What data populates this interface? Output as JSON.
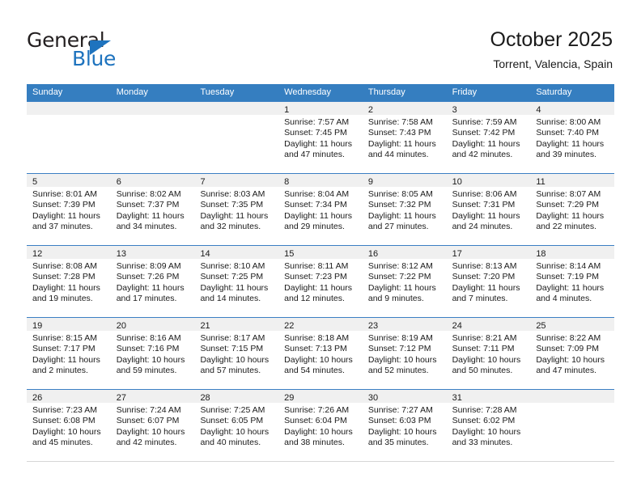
{
  "logo": {
    "name_part1": "General",
    "name_part2": "Blue",
    "accent_color": "#1e73be"
  },
  "header": {
    "title": "October 2025",
    "subtitle": "Torrent, Valencia, Spain"
  },
  "theme": {
    "header_bar_color": "#357ec0",
    "date_strip_color": "#f0f0f0",
    "row_border_color": "#3b7fc4"
  },
  "weekdays": [
    "Sunday",
    "Monday",
    "Tuesday",
    "Wednesday",
    "Thursday",
    "Friday",
    "Saturday"
  ],
  "weeks": [
    [
      {
        "day": "",
        "sunrise": "",
        "sunset": "",
        "daylight1": "",
        "daylight2": "",
        "empty": true
      },
      {
        "day": "",
        "sunrise": "",
        "sunset": "",
        "daylight1": "",
        "daylight2": "",
        "empty": true
      },
      {
        "day": "",
        "sunrise": "",
        "sunset": "",
        "daylight1": "",
        "daylight2": "",
        "empty": true
      },
      {
        "day": "1",
        "sunrise": "Sunrise: 7:57 AM",
        "sunset": "Sunset: 7:45 PM",
        "daylight1": "Daylight: 11 hours",
        "daylight2": "and 47 minutes."
      },
      {
        "day": "2",
        "sunrise": "Sunrise: 7:58 AM",
        "sunset": "Sunset: 7:43 PM",
        "daylight1": "Daylight: 11 hours",
        "daylight2": "and 44 minutes."
      },
      {
        "day": "3",
        "sunrise": "Sunrise: 7:59 AM",
        "sunset": "Sunset: 7:42 PM",
        "daylight1": "Daylight: 11 hours",
        "daylight2": "and 42 minutes."
      },
      {
        "day": "4",
        "sunrise": "Sunrise: 8:00 AM",
        "sunset": "Sunset: 7:40 PM",
        "daylight1": "Daylight: 11 hours",
        "daylight2": "and 39 minutes."
      }
    ],
    [
      {
        "day": "5",
        "sunrise": "Sunrise: 8:01 AM",
        "sunset": "Sunset: 7:39 PM",
        "daylight1": "Daylight: 11 hours",
        "daylight2": "and 37 minutes."
      },
      {
        "day": "6",
        "sunrise": "Sunrise: 8:02 AM",
        "sunset": "Sunset: 7:37 PM",
        "daylight1": "Daylight: 11 hours",
        "daylight2": "and 34 minutes."
      },
      {
        "day": "7",
        "sunrise": "Sunrise: 8:03 AM",
        "sunset": "Sunset: 7:35 PM",
        "daylight1": "Daylight: 11 hours",
        "daylight2": "and 32 minutes."
      },
      {
        "day": "8",
        "sunrise": "Sunrise: 8:04 AM",
        "sunset": "Sunset: 7:34 PM",
        "daylight1": "Daylight: 11 hours",
        "daylight2": "and 29 minutes."
      },
      {
        "day": "9",
        "sunrise": "Sunrise: 8:05 AM",
        "sunset": "Sunset: 7:32 PM",
        "daylight1": "Daylight: 11 hours",
        "daylight2": "and 27 minutes."
      },
      {
        "day": "10",
        "sunrise": "Sunrise: 8:06 AM",
        "sunset": "Sunset: 7:31 PM",
        "daylight1": "Daylight: 11 hours",
        "daylight2": "and 24 minutes."
      },
      {
        "day": "11",
        "sunrise": "Sunrise: 8:07 AM",
        "sunset": "Sunset: 7:29 PM",
        "daylight1": "Daylight: 11 hours",
        "daylight2": "and 22 minutes."
      }
    ],
    [
      {
        "day": "12",
        "sunrise": "Sunrise: 8:08 AM",
        "sunset": "Sunset: 7:28 PM",
        "daylight1": "Daylight: 11 hours",
        "daylight2": "and 19 minutes."
      },
      {
        "day": "13",
        "sunrise": "Sunrise: 8:09 AM",
        "sunset": "Sunset: 7:26 PM",
        "daylight1": "Daylight: 11 hours",
        "daylight2": "and 17 minutes."
      },
      {
        "day": "14",
        "sunrise": "Sunrise: 8:10 AM",
        "sunset": "Sunset: 7:25 PM",
        "daylight1": "Daylight: 11 hours",
        "daylight2": "and 14 minutes."
      },
      {
        "day": "15",
        "sunrise": "Sunrise: 8:11 AM",
        "sunset": "Sunset: 7:23 PM",
        "daylight1": "Daylight: 11 hours",
        "daylight2": "and 12 minutes."
      },
      {
        "day": "16",
        "sunrise": "Sunrise: 8:12 AM",
        "sunset": "Sunset: 7:22 PM",
        "daylight1": "Daylight: 11 hours",
        "daylight2": "and 9 minutes."
      },
      {
        "day": "17",
        "sunrise": "Sunrise: 8:13 AM",
        "sunset": "Sunset: 7:20 PM",
        "daylight1": "Daylight: 11 hours",
        "daylight2": "and 7 minutes."
      },
      {
        "day": "18",
        "sunrise": "Sunrise: 8:14 AM",
        "sunset": "Sunset: 7:19 PM",
        "daylight1": "Daylight: 11 hours",
        "daylight2": "and 4 minutes."
      }
    ],
    [
      {
        "day": "19",
        "sunrise": "Sunrise: 8:15 AM",
        "sunset": "Sunset: 7:17 PM",
        "daylight1": "Daylight: 11 hours",
        "daylight2": "and 2 minutes."
      },
      {
        "day": "20",
        "sunrise": "Sunrise: 8:16 AM",
        "sunset": "Sunset: 7:16 PM",
        "daylight1": "Daylight: 10 hours",
        "daylight2": "and 59 minutes."
      },
      {
        "day": "21",
        "sunrise": "Sunrise: 8:17 AM",
        "sunset": "Sunset: 7:15 PM",
        "daylight1": "Daylight: 10 hours",
        "daylight2": "and 57 minutes."
      },
      {
        "day": "22",
        "sunrise": "Sunrise: 8:18 AM",
        "sunset": "Sunset: 7:13 PM",
        "daylight1": "Daylight: 10 hours",
        "daylight2": "and 54 minutes."
      },
      {
        "day": "23",
        "sunrise": "Sunrise: 8:19 AM",
        "sunset": "Sunset: 7:12 PM",
        "daylight1": "Daylight: 10 hours",
        "daylight2": "and 52 minutes."
      },
      {
        "day": "24",
        "sunrise": "Sunrise: 8:21 AM",
        "sunset": "Sunset: 7:11 PM",
        "daylight1": "Daylight: 10 hours",
        "daylight2": "and 50 minutes."
      },
      {
        "day": "25",
        "sunrise": "Sunrise: 8:22 AM",
        "sunset": "Sunset: 7:09 PM",
        "daylight1": "Daylight: 10 hours",
        "daylight2": "and 47 minutes."
      }
    ],
    [
      {
        "day": "26",
        "sunrise": "Sunrise: 7:23 AM",
        "sunset": "Sunset: 6:08 PM",
        "daylight1": "Daylight: 10 hours",
        "daylight2": "and 45 minutes."
      },
      {
        "day": "27",
        "sunrise": "Sunrise: 7:24 AM",
        "sunset": "Sunset: 6:07 PM",
        "daylight1": "Daylight: 10 hours",
        "daylight2": "and 42 minutes."
      },
      {
        "day": "28",
        "sunrise": "Sunrise: 7:25 AM",
        "sunset": "Sunset: 6:05 PM",
        "daylight1": "Daylight: 10 hours",
        "daylight2": "and 40 minutes."
      },
      {
        "day": "29",
        "sunrise": "Sunrise: 7:26 AM",
        "sunset": "Sunset: 6:04 PM",
        "daylight1": "Daylight: 10 hours",
        "daylight2": "and 38 minutes."
      },
      {
        "day": "30",
        "sunrise": "Sunrise: 7:27 AM",
        "sunset": "Sunset: 6:03 PM",
        "daylight1": "Daylight: 10 hours",
        "daylight2": "and 35 minutes."
      },
      {
        "day": "31",
        "sunrise": "Sunrise: 7:28 AM",
        "sunset": "Sunset: 6:02 PM",
        "daylight1": "Daylight: 10 hours",
        "daylight2": "and 33 minutes."
      },
      {
        "day": "",
        "sunrise": "",
        "sunset": "",
        "daylight1": "",
        "daylight2": "",
        "empty": true
      }
    ]
  ]
}
